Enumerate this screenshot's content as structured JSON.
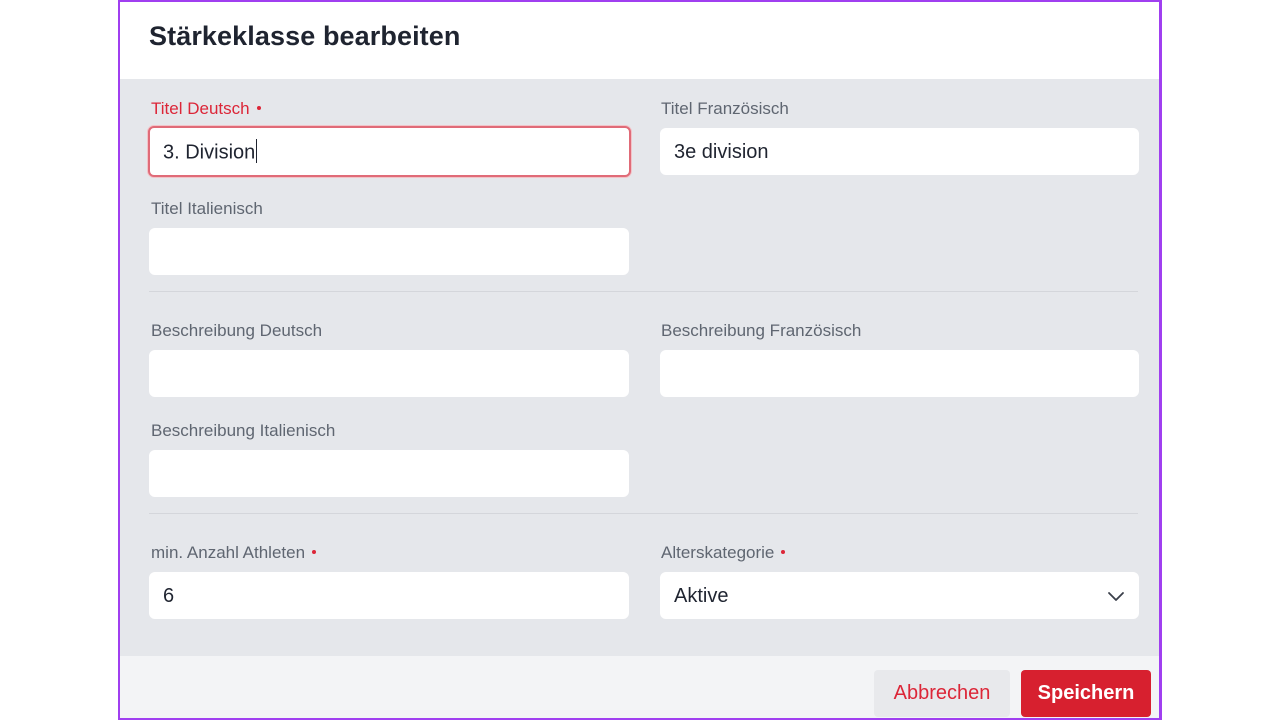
{
  "dialog": {
    "title": "Stärkeklasse bearbeiten"
  },
  "form": {
    "titel_de": {
      "label": "Titel Deutsch",
      "value": "3. Division",
      "required": true
    },
    "titel_fr": {
      "label": "Titel Französisch",
      "value": "3e division"
    },
    "titel_it": {
      "label": "Titel Italienisch",
      "value": ""
    },
    "beschreibung_de": {
      "label": "Beschreibung Deutsch",
      "value": ""
    },
    "beschreibung_fr": {
      "label": "Beschreibung Französisch",
      "value": ""
    },
    "beschreibung_it": {
      "label": "Beschreibung Italienisch",
      "value": ""
    },
    "min_athleten": {
      "label": "min. Anzahl Athleten",
      "value": "6",
      "required": true
    },
    "alterskategorie": {
      "label": "Alterskategorie",
      "value": "Aktive",
      "required": true
    }
  },
  "footer": {
    "cancel_label": "Abbrechen",
    "save_label": "Speichern"
  },
  "colors": {
    "accent": "#d7202f",
    "error": "#dc2638",
    "dialog_border": "#a03ff0"
  },
  "icons": {
    "select": "chevron-down-icon",
    "required": "required-dot-icon"
  }
}
